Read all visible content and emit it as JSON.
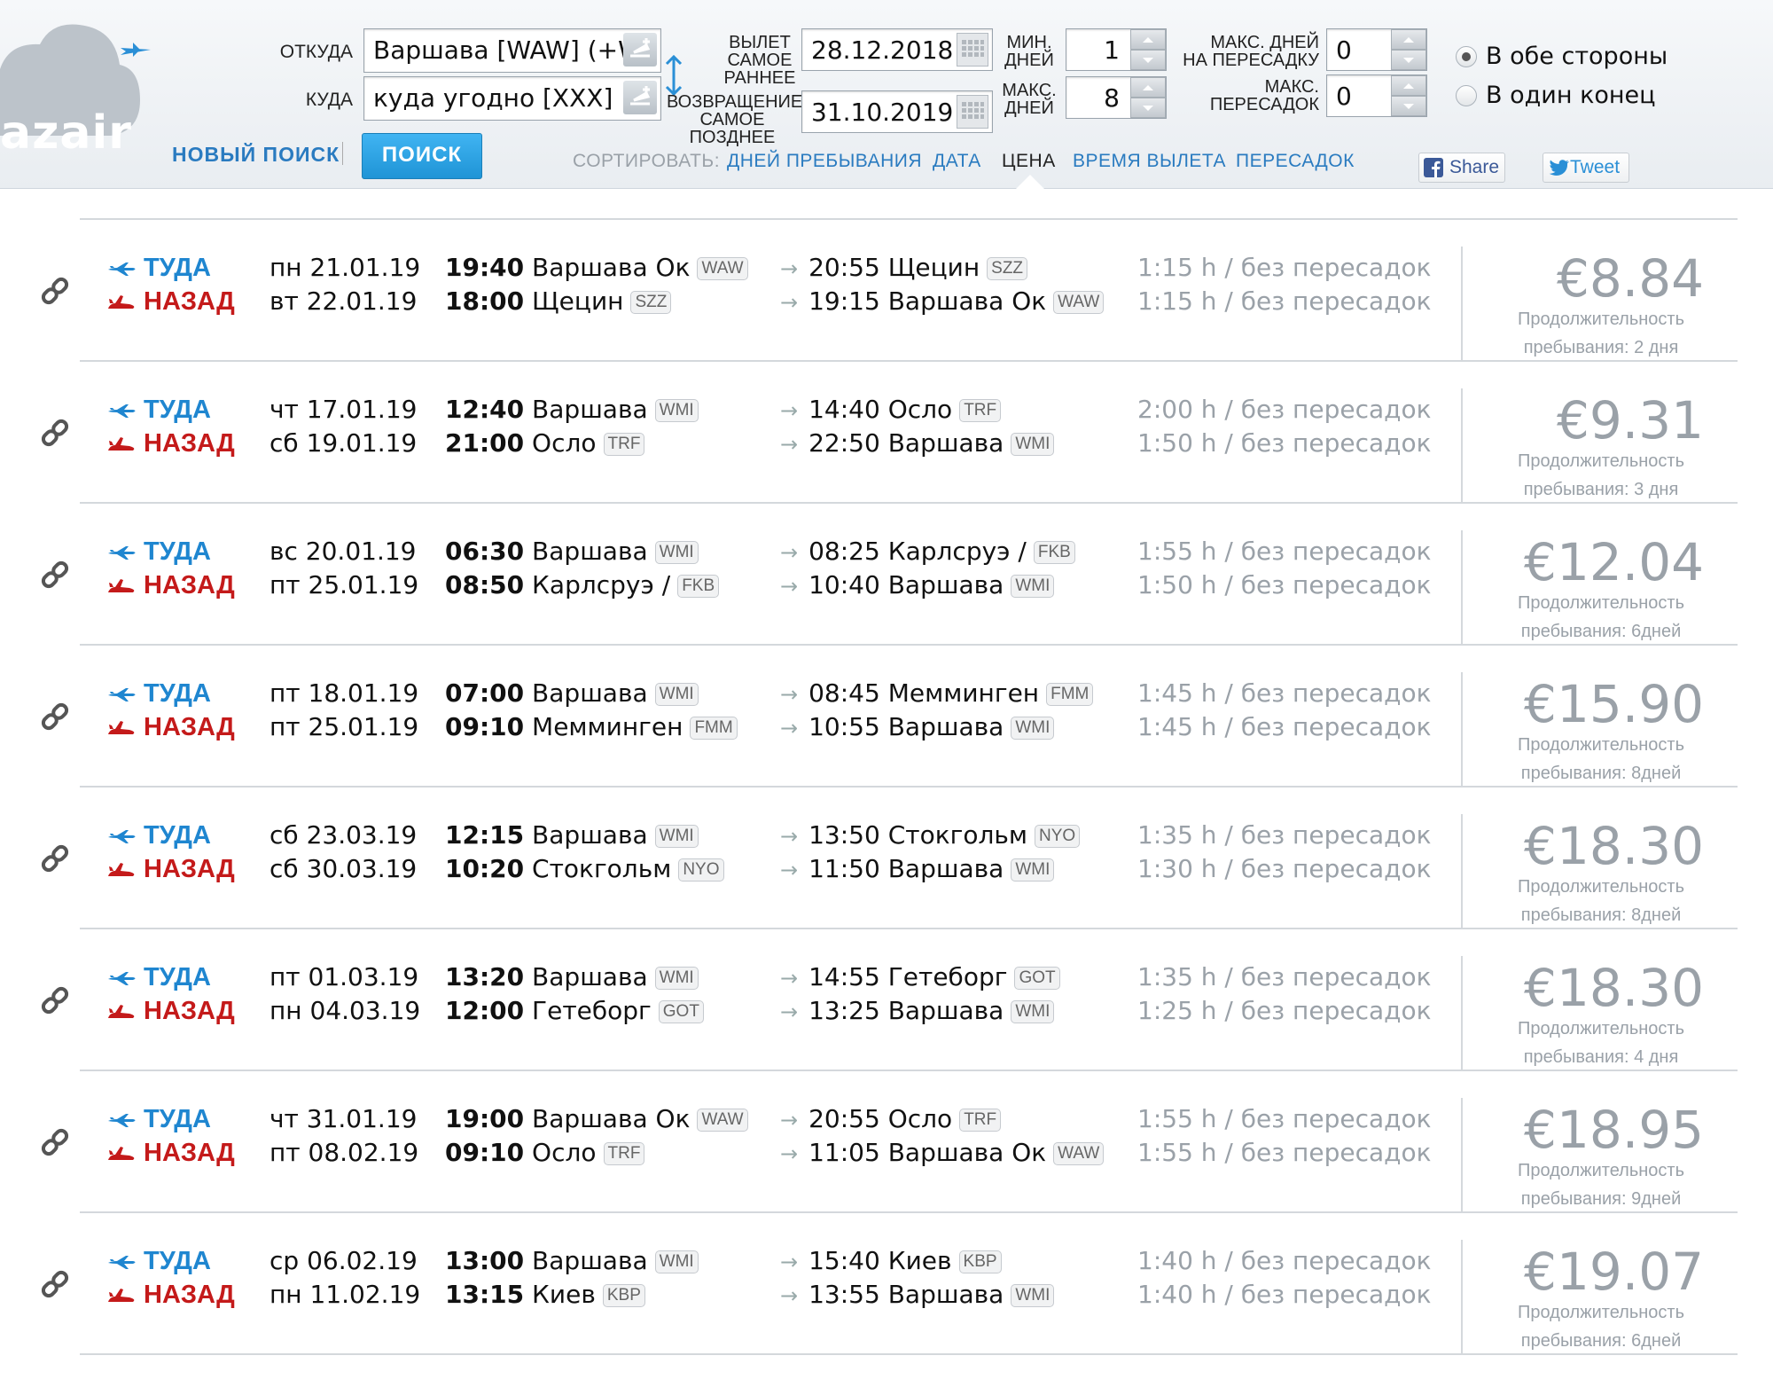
{
  "header": {
    "logo_text": "azair",
    "from_label": "ОТКУДА",
    "from_value": "Варшава [WAW] (+W",
    "to_label": "КУДА",
    "to_value": "куда угодно [XXX]",
    "dep_label_1": "ВЫЛЕТ",
    "dep_label_2": "САМОЕ",
    "dep_label_3": "РАННЕЕ",
    "dep_value": "28.12.2018",
    "ret_label_1": "ВОЗВРАЩЕНИЕ",
    "ret_label_2": "САМОЕ",
    "ret_label_3": "ПОЗДНЕЕ",
    "ret_value": "31.10.2019",
    "min_days_label_1": "МИН.",
    "min_days_label_2": "ДНЕЙ",
    "min_days_value": "1",
    "max_days_label_1": "МАКС.",
    "max_days_label_2": "ДНЕЙ",
    "max_days_value": "8",
    "max_transfer_days_label_1": "МАКС. ДНЕЙ",
    "max_transfer_days_label_2": "НА ПЕРЕСАДКУ",
    "max_transfer_days_value": "0",
    "max_changes_label_1": "МАКС.",
    "max_changes_label_2": "ПЕРЕСАДОК",
    "max_changes_value": "0",
    "radio_round": "В обе стороны",
    "radio_oneway": "В один конец",
    "new_search": "НОВЫЙ ПОИСК",
    "search_button": "ПОИСК",
    "sort_label": "СОРТИРОВАТЬ:",
    "sort_days": "ДНЕЙ ПРЕБЫВАНИЯ",
    "sort_date": "ДАТА",
    "sort_price": "ЦЕНА",
    "sort_time": "ВРЕМЯ ВЫЛЕТА",
    "sort_changes": "ПЕРЕСАДОК",
    "share": "Share",
    "tweet": "Tweet"
  },
  "labels": {
    "out": "ТУДА",
    "back": "НАЗАД"
  },
  "results": [
    {
      "out": {
        "date": "пн 21.01.19",
        "dep_time": "19:40",
        "dep_city": "Варшава Ок",
        "dep_code": "WAW",
        "arr_time": "20:55",
        "arr_city": "Щецин",
        "arr_code": "SZZ",
        "duration": "1:15 h / без пересадок"
      },
      "back": {
        "date": "вт 22.01.19",
        "dep_time": "18:00",
        "dep_city": "Щецин",
        "dep_code": "SZZ",
        "arr_time": "19:15",
        "arr_city": "Варшава Ок",
        "arr_code": "WAW",
        "duration": "1:15 h / без пересадок"
      },
      "price": "€8.84",
      "stay_1": "Продолжительность",
      "stay_2": "пребывания: 2 дня"
    },
    {
      "out": {
        "date": "чт 17.01.19",
        "dep_time": "12:40",
        "dep_city": "Варшава",
        "dep_code": "WMI",
        "arr_time": "14:40",
        "arr_city": "Осло",
        "arr_code": "TRF",
        "duration": "2:00 h / без пересадок"
      },
      "back": {
        "date": "сб 19.01.19",
        "dep_time": "21:00",
        "dep_city": "Осло",
        "dep_code": "TRF",
        "arr_time": "22:50",
        "arr_city": "Варшава",
        "arr_code": "WMI",
        "duration": "1:50 h / без пересадок"
      },
      "price": "€9.31",
      "stay_1": "Продолжительность",
      "stay_2": "пребывания: 3 дня"
    },
    {
      "out": {
        "date": "вс 20.01.19",
        "dep_time": "06:30",
        "dep_city": "Варшава",
        "dep_code": "WMI",
        "arr_time": "08:25",
        "arr_city": "Карлсруэ /",
        "arr_code": "FKB",
        "duration": "1:55 h / без пересадок"
      },
      "back": {
        "date": "пт 25.01.19",
        "dep_time": "08:50",
        "dep_city": "Карлсруэ /",
        "dep_code": "FKB",
        "arr_time": "10:40",
        "arr_city": "Варшава",
        "arr_code": "WMI",
        "duration": "1:50 h / без пересадок"
      },
      "price": "€12.04",
      "stay_1": "Продолжительность",
      "stay_2": "пребывания: 6дней"
    },
    {
      "out": {
        "date": "пт 18.01.19",
        "dep_time": "07:00",
        "dep_city": "Варшава",
        "dep_code": "WMI",
        "arr_time": "08:45",
        "arr_city": "Мемминген",
        "arr_code": "FMM",
        "duration": "1:45 h / без пересадок"
      },
      "back": {
        "date": "пт 25.01.19",
        "dep_time": "09:10",
        "dep_city": "Мемминген",
        "dep_code": "FMM",
        "arr_time": "10:55",
        "arr_city": "Варшава",
        "arr_code": "WMI",
        "duration": "1:45 h / без пересадок"
      },
      "price": "€15.90",
      "stay_1": "Продолжительность",
      "stay_2": "пребывания: 8дней"
    },
    {
      "out": {
        "date": "сб 23.03.19",
        "dep_time": "12:15",
        "dep_city": "Варшава",
        "dep_code": "WMI",
        "arr_time": "13:50",
        "arr_city": "Стокгольм",
        "arr_code": "NYO",
        "duration": "1:35 h / без пересадок"
      },
      "back": {
        "date": "сб 30.03.19",
        "dep_time": "10:20",
        "dep_city": "Стокгольм",
        "dep_code": "NYO",
        "arr_time": "11:50",
        "arr_city": "Варшава",
        "arr_code": "WMI",
        "duration": "1:30 h / без пересадок"
      },
      "price": "€18.30",
      "stay_1": "Продолжительность",
      "stay_2": "пребывания: 8дней"
    },
    {
      "out": {
        "date": "пт 01.03.19",
        "dep_time": "13:20",
        "dep_city": "Варшава",
        "dep_code": "WMI",
        "arr_time": "14:55",
        "arr_city": "Гетеборг",
        "arr_code": "GOT",
        "duration": "1:35 h / без пересадок"
      },
      "back": {
        "date": "пн 04.03.19",
        "dep_time": "12:00",
        "dep_city": "Гетеборг",
        "dep_code": "GOT",
        "arr_time": "13:25",
        "arr_city": "Варшава",
        "arr_code": "WMI",
        "duration": "1:25 h / без пересадок"
      },
      "price": "€18.30",
      "stay_1": "Продолжительность",
      "stay_2": "пребывания: 4 дня"
    },
    {
      "out": {
        "date": "чт 31.01.19",
        "dep_time": "19:00",
        "dep_city": "Варшава Ок",
        "dep_code": "WAW",
        "arr_time": "20:55",
        "arr_city": "Осло",
        "arr_code": "TRF",
        "duration": "1:55 h / без пересадок"
      },
      "back": {
        "date": "пт 08.02.19",
        "dep_time": "09:10",
        "dep_city": "Осло",
        "dep_code": "TRF",
        "arr_time": "11:05",
        "arr_city": "Варшава Ок",
        "arr_code": "WAW",
        "duration": "1:55 h / без пересадок"
      },
      "price": "€18.95",
      "stay_1": "Продолжительность",
      "stay_2": "пребывания: 9дней"
    },
    {
      "out": {
        "date": "ср 06.02.19",
        "dep_time": "13:00",
        "dep_city": "Варшава",
        "dep_code": "WMI",
        "arr_time": "15:40",
        "arr_city": "Киев",
        "arr_code": "KBP",
        "duration": "1:40 h / без пересадок"
      },
      "back": {
        "date": "пн 11.02.19",
        "dep_time": "13:15",
        "dep_city": "Киев",
        "dep_code": "KBP",
        "arr_time": "13:55",
        "arr_city": "Варшава",
        "arr_code": "WMI",
        "duration": "1:40 h / без пересадок"
      },
      "price": "€19.07",
      "stay_1": "Продолжительность",
      "stay_2": "пребывания: 6дней"
    }
  ]
}
